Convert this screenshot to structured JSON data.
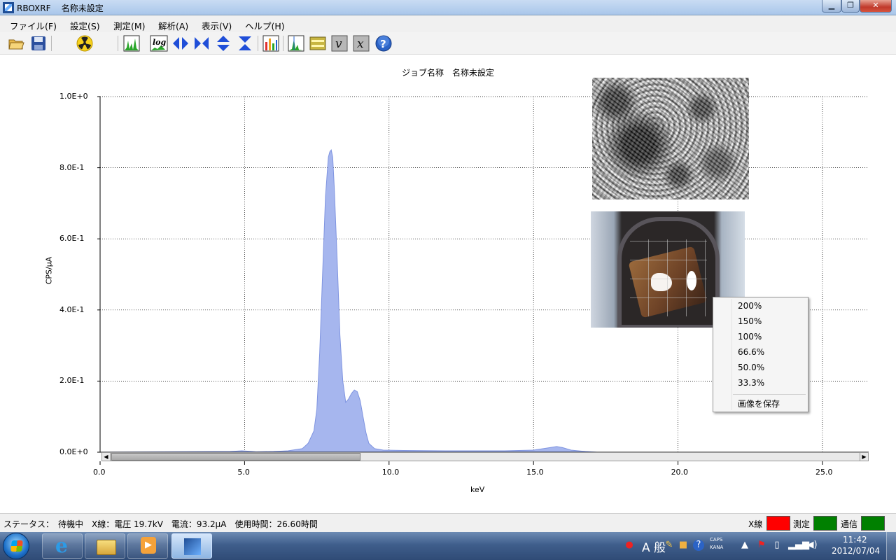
{
  "window": {
    "app_name": "RBOXRF",
    "doc_name": "名称未設定",
    "min_glyph": "▁",
    "max_glyph": "❐",
    "close_glyph": "✕"
  },
  "menu": [
    "ファイル(F)",
    "設定(S)",
    "測定(M)",
    "解析(A)",
    "表示(V)",
    "ヘルプ(H)"
  ],
  "toolbar": {
    "log_label": "log",
    "v_label": "v",
    "x_label": "x",
    "help_glyph": "?",
    "icons": [
      "open-folder-icon",
      "save-icon",
      "radiation-icon",
      "spectrum-icon",
      "log-scale-icon",
      "expand-horizontal-icon",
      "shrink-horizontal-icon",
      "expand-vertical-icon",
      "shrink-vertical-icon",
      "bar-chart-icon",
      "peak-icon",
      "layers-icon",
      "v-icon",
      "x-icon",
      "help-icon"
    ]
  },
  "chart_data": {
    "type": "area",
    "title": "ジョブ名称　名称未設定",
    "xlabel": "keV",
    "ylabel": "CPS/μA",
    "xlim": [
      0,
      26.6
    ],
    "ylim": [
      0,
      1.0
    ],
    "xticks": [
      "0.0",
      "5.0",
      "10.0",
      "15.0",
      "20.0",
      "25.0"
    ],
    "yticks": [
      "0.0E+0",
      "2.0E-1",
      "4.0E-1",
      "6.0E-1",
      "8.0E-1",
      "1.0E+0"
    ],
    "grid": true,
    "color": "#a6b6ee",
    "stroke": "#7f94e0",
    "x": [
      0.0,
      4.5,
      4.9,
      5.1,
      5.4,
      6.0,
      6.5,
      7.0,
      7.2,
      7.4,
      7.5,
      7.6,
      7.7,
      7.8,
      7.9,
      7.95,
      8.0,
      8.05,
      8.1,
      8.2,
      8.3,
      8.4,
      8.5,
      8.6,
      8.7,
      8.8,
      8.9,
      9.0,
      9.1,
      9.2,
      9.3,
      9.5,
      9.8,
      10.5,
      12.0,
      14.0,
      15.0,
      15.5,
      15.8,
      16.0,
      16.3,
      16.8,
      17.2
    ],
    "y": [
      0.0,
      0.002,
      0.004,
      0.003,
      0.001,
      0.002,
      0.004,
      0.01,
      0.025,
      0.06,
      0.12,
      0.28,
      0.5,
      0.72,
      0.83,
      0.845,
      0.85,
      0.83,
      0.75,
      0.55,
      0.33,
      0.2,
      0.14,
      0.15,
      0.165,
      0.175,
      0.17,
      0.145,
      0.1,
      0.055,
      0.025,
      0.01,
      0.006,
      0.005,
      0.004,
      0.004,
      0.006,
      0.012,
      0.016,
      0.013,
      0.006,
      0.002,
      0.0
    ]
  },
  "images": {
    "sem": "sem-image",
    "camera": "camera-image"
  },
  "context_menu": {
    "zoom_options": [
      "200%",
      "150%",
      "100%",
      "66.6%",
      "50.0%",
      "33.3%"
    ],
    "save_image": "画像を保存"
  },
  "scrollbar": {
    "left_arrow": "◀",
    "right_arrow": "▶"
  },
  "status": {
    "text": "ステータス：　待機中　X線：電圧 19.7kV　電流：93.2μA　使用時間：26.60時間",
    "indicators": [
      {
        "label": "X線",
        "color": "#ff0000"
      },
      {
        "label": "測定",
        "color": "#008000"
      },
      {
        "label": "通信",
        "color": "#008000"
      }
    ]
  },
  "taskbar": {
    "ime": "A 般",
    "caps": "CAPS\nKANA",
    "time": "11:42",
    "date": "2012/07/04"
  }
}
